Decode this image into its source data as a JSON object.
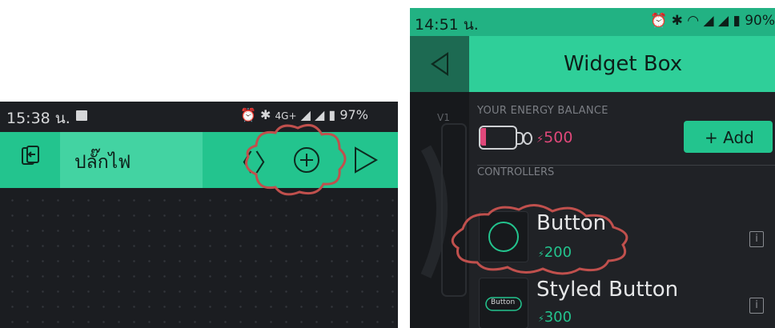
{
  "left_screen": {
    "status_bar": {
      "time": "15:38 น.",
      "network": "4G+",
      "battery": "97%"
    },
    "toolbar": {
      "project_title": "ปลั๊กไฟ"
    }
  },
  "right_screen": {
    "status_bar": {
      "time": "14:51 น.",
      "battery": "90%"
    },
    "header": {
      "title": "Widget Box"
    },
    "side_label": "V1",
    "energy": {
      "label": "YOUR ENERGY BALANCE",
      "value": "500",
      "add_label": "+ Add"
    },
    "section_label": "CONTROLLERS",
    "widgets": [
      {
        "name": "Button",
        "price": "200",
        "icon_label": ""
      },
      {
        "name": "Styled Button",
        "price": "300",
        "icon_label": "Button"
      }
    ],
    "info_glyph": "i",
    "energy_glyph": "⚡"
  },
  "colors": {
    "accent_green": "#23c48e",
    "energy_red": "#e0487a",
    "annotation_red": "#c0504d"
  }
}
